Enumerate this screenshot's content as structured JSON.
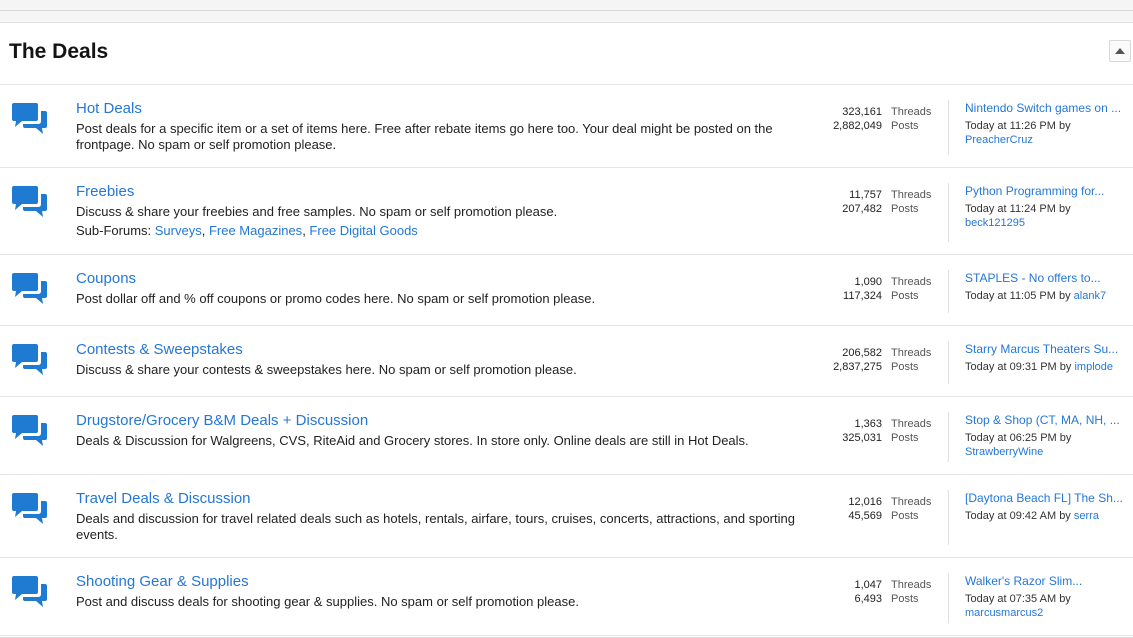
{
  "section": {
    "title": "The Deals"
  },
  "labels": {
    "threads": "Threads",
    "posts": "Posts",
    "by": "by",
    "subforums": "Sub-Forums:"
  },
  "colors": {
    "accent": "#2577d6",
    "icon": "#1f7ad1"
  },
  "forums": [
    {
      "title": "Hot Deals",
      "desc": "Post deals for a specific item or a set of items here. Free after rebate items go here too. Your deal might be posted on the frontpage. No spam or self promotion please.",
      "threads": "323,161",
      "posts": "2,882,049",
      "latest_title": "Nintendo Switch games on ...",
      "latest_time": "Today at 11:26 PM",
      "latest_user": "PreacherCruz"
    },
    {
      "title": "Freebies",
      "desc": "Discuss & share your freebies and free samples. No spam or self promotion please.",
      "subforums": [
        "Surveys",
        "Free Magazines",
        "Free Digital Goods"
      ],
      "threads": "11,757",
      "posts": "207,482",
      "latest_title": "Python Programming for...",
      "latest_time": "Today at 11:24 PM",
      "latest_user": "beck121295"
    },
    {
      "title": "Coupons",
      "desc": "Post dollar off and % off coupons or promo codes here. No spam or self promotion please.",
      "threads": "1,090",
      "posts": "117,324",
      "latest_title": "STAPLES - No offers to...",
      "latest_time": "Today at 11:05 PM",
      "latest_user": "alank7"
    },
    {
      "title": "Contests & Sweepstakes",
      "desc": "Discuss & share your contests & sweepstakes here. No spam or self promotion please.",
      "threads": "206,582",
      "posts": "2,837,275",
      "latest_title": "Starry Marcus Theaters Su...",
      "latest_time": "Today at 09:31 PM",
      "latest_user": "implode"
    },
    {
      "title": "Drugstore/Grocery B&M Deals + Discussion",
      "desc": "Deals & Discussion for Walgreens, CVS, RiteAid and Grocery stores. In store only. Online deals are still in Hot Deals.",
      "threads": "1,363",
      "posts": "325,031",
      "latest_title": "Stop & Shop (CT, MA, NH, ...",
      "latest_time": "Today at 06:25 PM",
      "latest_user": "StrawberryWine"
    },
    {
      "title": "Travel Deals & Discussion",
      "desc": "Deals and discussion for travel related deals such as hotels, rentals, airfare, tours, cruises, concerts, attractions, and sporting events.",
      "threads": "12,016",
      "posts": "45,569",
      "latest_title": "[Daytona Beach FL] The Sh...",
      "latest_time": "Today at 09:42 AM",
      "latest_user": "serra"
    },
    {
      "title": "Shooting Gear & Supplies",
      "desc": "Post and discuss deals for shooting gear & supplies. No spam or self promotion please.",
      "threads": "1,047",
      "posts": "6,493",
      "latest_title": "Walker's Razor Slim...",
      "latest_time": "Today at 07:35 AM",
      "latest_user": "marcusmarcus2"
    }
  ]
}
